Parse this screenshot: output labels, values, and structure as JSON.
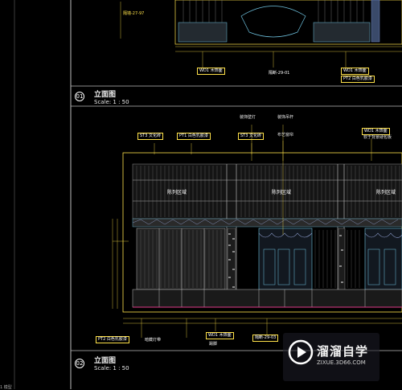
{
  "top_section": {
    "label_tl": "隔墙-27-97",
    "tags": [
      "WD1 木饰面",
      "隔断-29-01",
      "WD1 木饰面",
      "PT2 白色乳胶漆"
    ]
  },
  "views": [
    {
      "number": "01",
      "title": "立面图",
      "scale": "Scale: 1 : 50"
    },
    {
      "number": "02",
      "title": "立面图",
      "scale": "Scale: 1 : 50"
    }
  ],
  "callouts": {
    "top_left_1": "ST3 文化砖",
    "top_left_2": "PT1 白色乳胶漆",
    "top_mid_1": "装饰壁灯",
    "top_mid_2": "ST3 文化砖",
    "top_right_1": "装饰吊杆",
    "top_right_2": "布艺窗帘",
    "top_far_right_1": "WD1 木饰面",
    "top_far_right_2": "软于背景硬包板",
    "bottom_1": "PT2 白色乳胶漆",
    "bottom_2": "暗藏灯带",
    "bottom_3": "WD1 木饰面",
    "bottom_3b": "踢脚",
    "bottom_4": "隔断-29-03"
  },
  "zones": [
    "陈列区域",
    "陈列区域",
    "陈列区域"
  ],
  "watermark": {
    "name": "溜溜自学",
    "url": "ZIXUE.3D66.COM"
  },
  "status_text": "1 模型"
}
